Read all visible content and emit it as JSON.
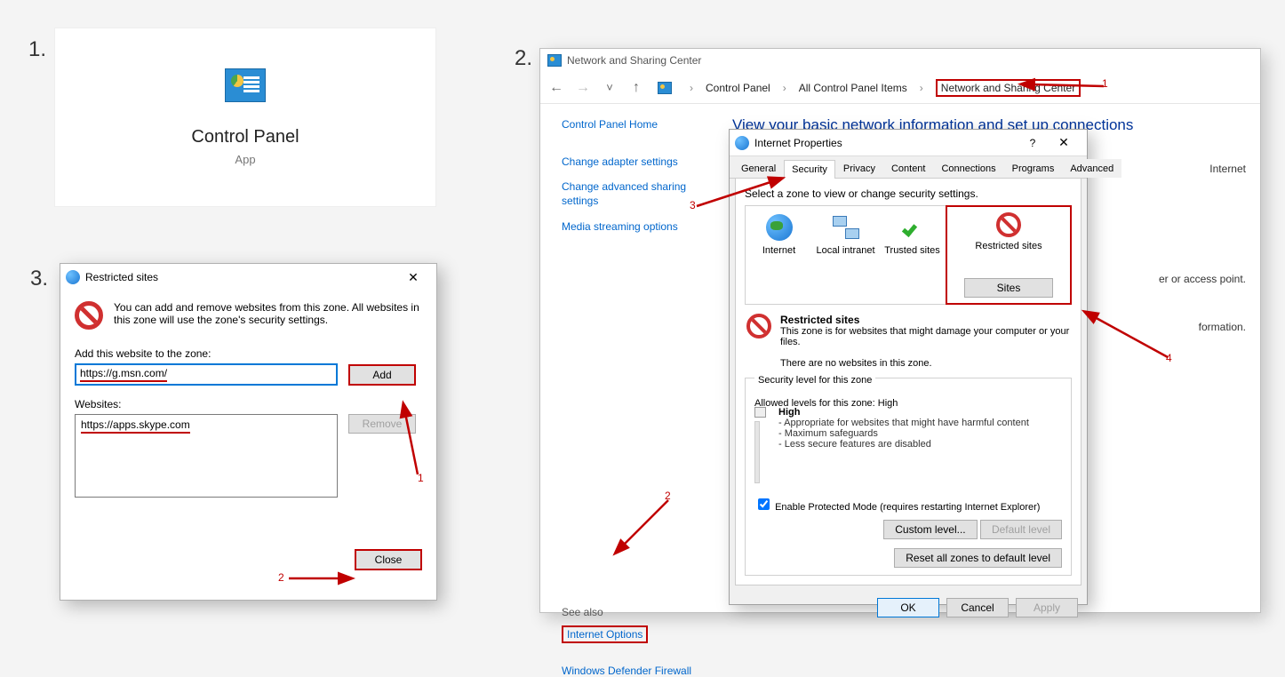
{
  "step1": {
    "title": "Control Panel",
    "subtitle": "App"
  },
  "step3": {
    "dialog_title": "Restricted sites",
    "description": "You can add and remove websites from this zone. All websites in this zone will use the zone's security settings.",
    "add_label": "Add this website to the zone:",
    "add_value": "https://g.msn.com/",
    "add_button": "Add",
    "websites_label": "Websites:",
    "website_item": "https://apps.skype.com",
    "remove_button": "Remove",
    "close_button": "Close",
    "annot1": "1",
    "annot2": "2"
  },
  "ns": {
    "window_title": "Network and Sharing Center",
    "breadcrumb": {
      "root": "Control Panel",
      "mid": "All Control Panel Items",
      "leaf": "Network and Sharing Center"
    },
    "side": {
      "home": "Control Panel Home",
      "adapter": "Change adapter settings",
      "advanced": "Change advanced sharing settings",
      "media": "Media streaming options",
      "see_also": "See also",
      "internet_options": "Internet Options",
      "firewall": "Windows Defender Firewall"
    },
    "main": {
      "heading": "View your basic network information and set up connections",
      "internet_label": "Internet",
      "access_text": "er or access point.",
      "info_text": "formation."
    },
    "annot1": "1",
    "annot2": "2",
    "annot3": "3",
    "annot4": "4"
  },
  "iprop": {
    "title": "Internet Properties",
    "tabs": {
      "general": "General",
      "security": "Security",
      "privacy": "Privacy",
      "content": "Content",
      "connections": "Connections",
      "programs": "Programs",
      "advanced": "Advanced"
    },
    "zone_prompt": "Select a zone to view or change security settings.",
    "zones": {
      "internet": "Internet",
      "intranet": "Local intranet",
      "trusted": "Trusted sites",
      "restricted": "Restricted sites"
    },
    "sites_button": "Sites",
    "rs_heading": "Restricted sites",
    "rs_desc": "This zone is for websites that might damage your computer or your files.",
    "rs_empty": "There are no websites in this zone.",
    "sec_level_legend": "Security level for this zone",
    "allowed": "Allowed levels for this zone: High",
    "high": "High",
    "b1": "Appropriate for websites that might have harmful content",
    "b2": "Maximum safeguards",
    "b3": "Less secure features are disabled",
    "protected": "Enable Protected Mode (requires restarting Internet Explorer)",
    "custom": "Custom level...",
    "default": "Default level",
    "reset": "Reset all zones to default level",
    "ok": "OK",
    "cancel": "Cancel",
    "apply": "Apply"
  }
}
